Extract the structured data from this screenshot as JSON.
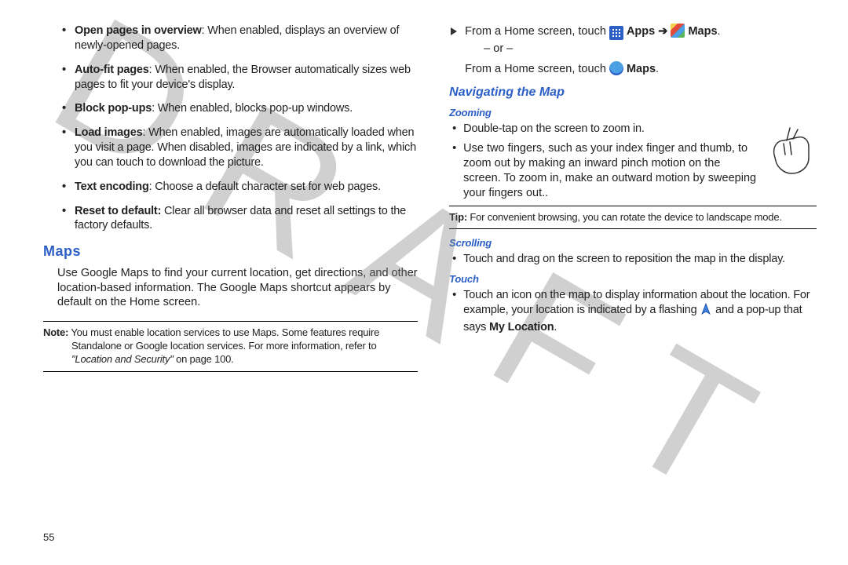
{
  "watermark": "DRAFT",
  "page_number": "55",
  "left": {
    "bullets": [
      {
        "term": "Open pages in overview",
        "desc": ": When enabled, displays an overview of newly-opened pages."
      },
      {
        "term": "Auto-fit pages",
        "desc": ": When enabled, the Browser automatically sizes web pages to fit your device's display."
      },
      {
        "term": "Block pop-ups",
        "desc": ": When enabled, blocks pop-up windows."
      },
      {
        "term": "Load images",
        "desc": ": When enabled, images are automatically loaded when you visit a page. When disabled, images are indicated by a link, which you can touch to download the picture."
      },
      {
        "term": "Text encoding",
        "desc": ": Choose a default character set for web pages."
      },
      {
        "term": "Reset to default:",
        "desc": " Clear all browser data and reset all settings to the factory defaults."
      }
    ],
    "section_title": "Maps",
    "intro": "Use Google Maps to find your current location, get directions, and other location-based information. The Google Maps shortcut appears by default on the Home screen.",
    "note_lead": "Note:",
    "note_body1": " You must enable location services to use Maps. Some features require Standalone or Google location services. For more information, refer to ",
    "note_ref": "\"Location and Security\"",
    "note_body2": "  on page 100."
  },
  "right": {
    "step1_a": "From a Home screen, touch ",
    "apps_label": "Apps",
    "arrow_char": "➔",
    "maps_label": "Maps",
    "period": ".",
    "or": "– or –",
    "step1_b": "From a Home screen, touch ",
    "subsection": "Navigating the Map",
    "zooming_title": "Zooming",
    "zooming_b1": "Double-tap on the screen to zoom in.",
    "zooming_b2": "Use two fingers, such as your index finger and thumb, to zoom out by making an inward pinch motion on the screen. To zoom in, make an outward motion by sweeping your fingers out..",
    "tip_lead": "Tip:",
    "tip_body": " For convenient browsing, you can rotate the device to landscape mode.",
    "scrolling_title": "Scrolling",
    "scrolling_b1": "Touch and drag on the screen to reposition the map in the display.",
    "touch_title": "Touch",
    "touch_b1a": "Touch an icon on the map to display information about the location. For example, your location is indicated by a flashing ",
    "touch_b1b": " and a pop-up that says ",
    "my_location": "My Location",
    "touch_b1c": "."
  }
}
